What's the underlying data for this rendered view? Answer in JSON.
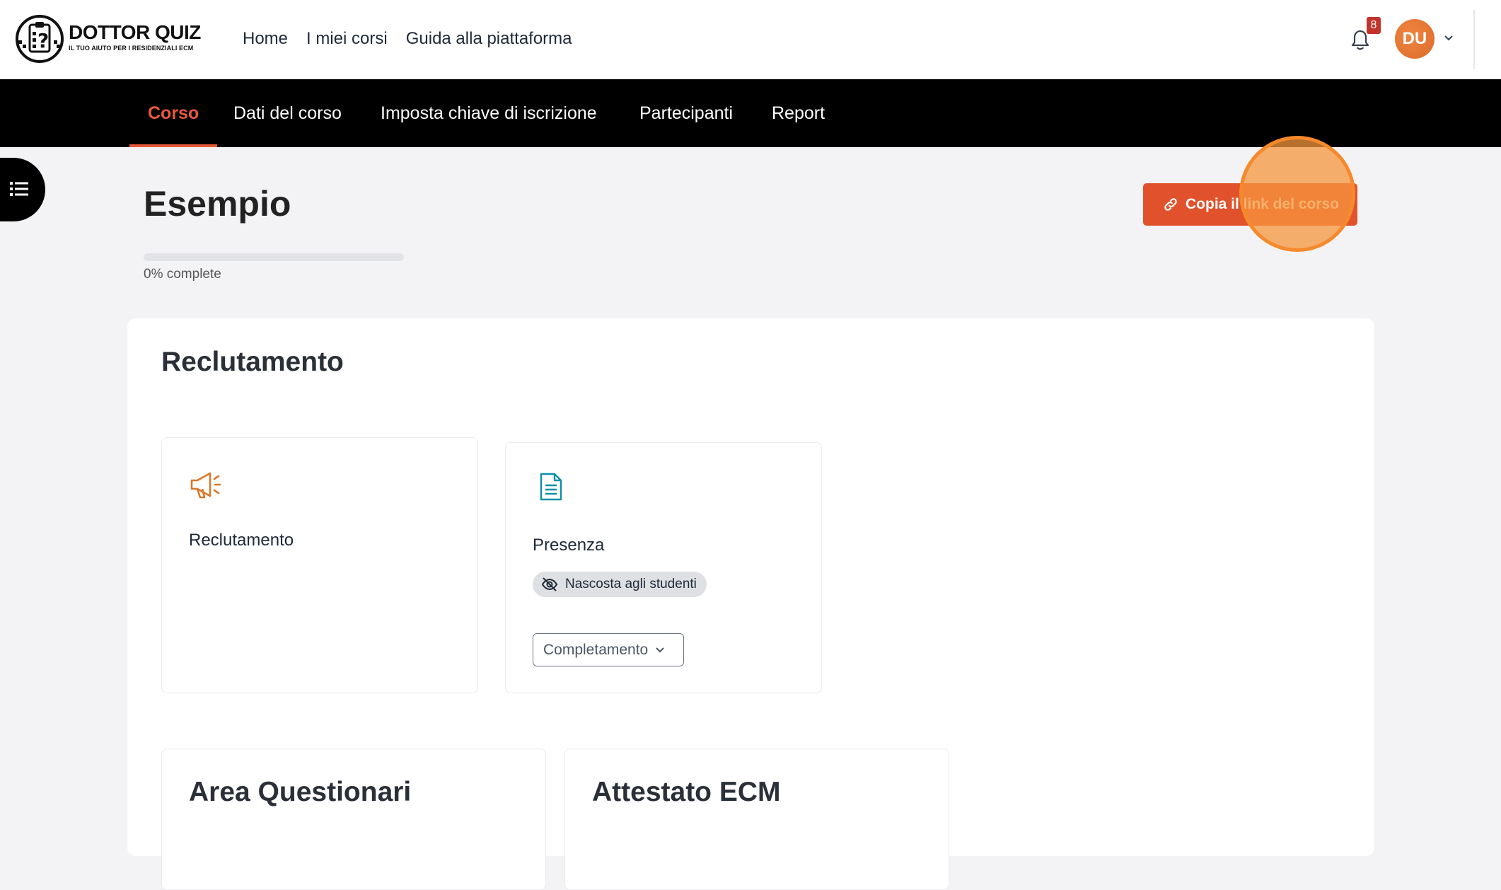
{
  "brand": {
    "name": "DOTTOR QUIZ",
    "tagline": "IL TUO AIUTO PER I RESIDENZIALI ECM"
  },
  "top_nav": [
    "Home",
    "I miei corsi",
    "Guida alla piattaforma"
  ],
  "notifications": {
    "count": "8"
  },
  "user": {
    "initials": "DU"
  },
  "course_nav": [
    {
      "label": "Corso",
      "active": true
    },
    {
      "label": "Dati del corso",
      "active": false
    },
    {
      "label": "Imposta chiave di iscrizione",
      "active": false
    },
    {
      "label": "Partecipanti",
      "active": false
    },
    {
      "label": "Report",
      "active": false
    }
  ],
  "course": {
    "title": "Esempio",
    "progress_percent": 0,
    "progress_label": "0% complete",
    "copy_link_label": "Copia il link del corso"
  },
  "section": {
    "title": "Reclutamento",
    "activities": [
      {
        "name": "Reclutamento",
        "icon": "megaphone-icon"
      },
      {
        "name": "Presenza",
        "icon": "document-icon",
        "badge": "Nascosta agli studenti",
        "completion_label": "Completamento"
      }
    ]
  },
  "subsections": [
    "Area Questionari",
    "Attestato ECM"
  ],
  "colors": {
    "accent": "#e1522c",
    "active_tab": "#e8593a",
    "highlight": "#f5892b",
    "nav_bg": "#000000"
  }
}
